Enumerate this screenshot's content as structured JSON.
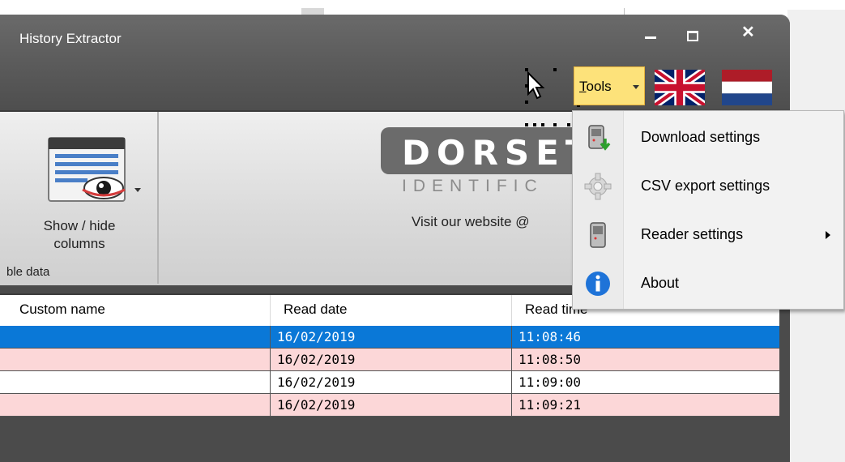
{
  "window": {
    "title": "History Extractor",
    "controls": {
      "minimize_icon": "minimize-icon",
      "maximize_icon": "maximize-icon",
      "close_icon": "close-icon"
    }
  },
  "toolbar": {
    "tools_label_mnemonic": "T",
    "tools_label_rest": "ools",
    "languages": [
      "english-flag-icon",
      "dutch-flag-icon"
    ]
  },
  "ribbon": {
    "show_hide_line1": "Show / hide",
    "show_hide_line2": "columns",
    "group_label": "ble data",
    "logo_text": "DORSET",
    "logo_sub": "IDENTIFIC",
    "visit_text": "Visit our website @"
  },
  "table": {
    "headers": [
      "Custom name",
      "Read date",
      "Read time"
    ],
    "rows": [
      {
        "custom_name": "",
        "read_date": "16/02/2019",
        "read_time": "11:08:46",
        "state": "selected"
      },
      {
        "custom_name": "",
        "read_date": "16/02/2019",
        "read_time": "11:08:50",
        "state": "alt"
      },
      {
        "custom_name": "",
        "read_date": "16/02/2019",
        "read_time": "11:09:00",
        "state": "normal"
      },
      {
        "custom_name": "",
        "read_date": "16/02/2019",
        "read_time": "11:09:21",
        "state": "alt"
      }
    ]
  },
  "menu": {
    "items": [
      {
        "label": "Download settings",
        "icon": "download-device-icon"
      },
      {
        "label": "CSV export settings",
        "icon": "gear-icon"
      },
      {
        "label": "Reader settings",
        "icon": "reader-device-icon",
        "has_submenu": true
      },
      {
        "label": "About",
        "icon": "info-icon"
      }
    ]
  },
  "colors": {
    "selected_row": "#0a78d7",
    "alt_row": "#fcd7d8",
    "tools_highlight": "#fde27a"
  }
}
